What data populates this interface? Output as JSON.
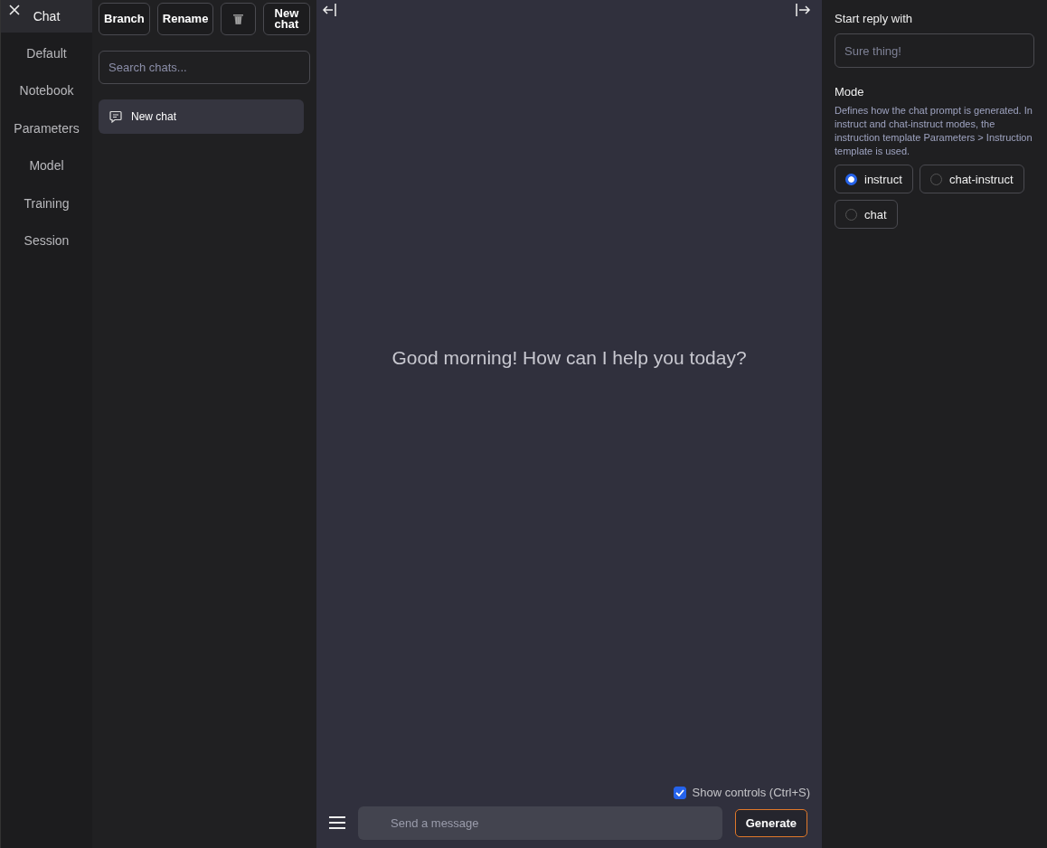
{
  "nav": {
    "tabs": [
      {
        "label": "Chat",
        "selected": true
      },
      {
        "label": "Default",
        "selected": false
      },
      {
        "label": "Notebook",
        "selected": false
      },
      {
        "label": "Parameters",
        "selected": false
      },
      {
        "label": "Model",
        "selected": false
      },
      {
        "label": "Training",
        "selected": false
      },
      {
        "label": "Session",
        "selected": false
      }
    ]
  },
  "chat_panel": {
    "buttons": [
      {
        "kind": "text",
        "label": "Branch"
      },
      {
        "kind": "text",
        "label": "Rename"
      },
      {
        "kind": "trash"
      },
      {
        "kind": "text",
        "label": "New chat"
      }
    ],
    "search": {
      "placeholder": "Search chats..."
    },
    "chats": [
      {
        "title": "New chat",
        "selected": true
      }
    ]
  },
  "main": {
    "greeting": "Good morning! How can I help you today?",
    "show_controls": {
      "label": "Show controls (Ctrl+S)",
      "checked": true
    },
    "message": {
      "placeholder": "Send a message"
    },
    "generate": "Generate"
  },
  "options": {
    "start_reply": {
      "label": "Start reply with",
      "placeholder": "Sure thing!"
    },
    "mode": {
      "label": "Mode",
      "description": "Defines how the chat prompt is generated. In instruct and chat-instruct modes, the instruction template Parameters > Instruction template is used.",
      "options": [
        {
          "label": "instruct",
          "selected": true
        },
        {
          "label": "chat-instruct",
          "selected": false
        },
        {
          "label": "chat",
          "selected": false
        }
      ]
    }
  }
}
